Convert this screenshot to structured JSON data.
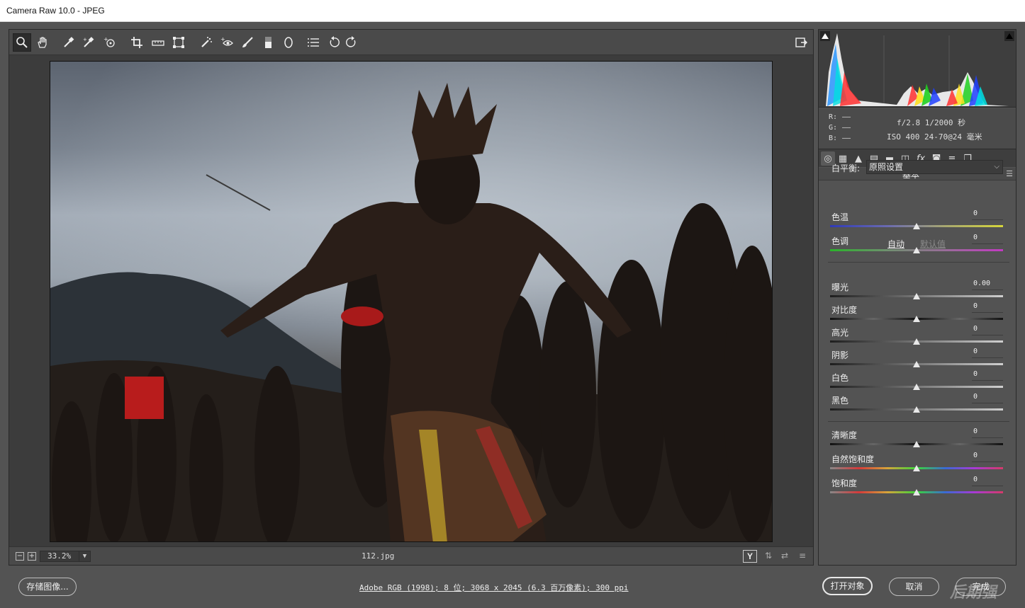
{
  "window": {
    "title": "Camera Raw 10.0 -  JPEG"
  },
  "toolbar": {
    "tools": [
      {
        "name": "zoom-tool",
        "glyph": "zoom",
        "active": true
      },
      {
        "name": "hand-tool",
        "glyph": "hand"
      },
      {
        "name": "white-balance-tool",
        "glyph": "eyedropper"
      },
      {
        "name": "color-sampler-tool",
        "glyph": "sampler"
      },
      {
        "name": "targeted-adjustment-tool",
        "glyph": "target"
      },
      {
        "name": "crop-tool",
        "glyph": "crop"
      },
      {
        "name": "straighten-tool",
        "glyph": "level"
      },
      {
        "name": "transform-tool",
        "glyph": "transform"
      },
      {
        "name": "spot-removal-tool",
        "glyph": "spot"
      },
      {
        "name": "red-eye-tool",
        "glyph": "eye"
      },
      {
        "name": "adjustment-brush-tool",
        "glyph": "brush"
      },
      {
        "name": "graduated-filter-tool",
        "glyph": "gradient"
      },
      {
        "name": "radial-filter-tool",
        "glyph": "radial"
      },
      {
        "name": "preferences-tool",
        "glyph": "list"
      },
      {
        "name": "rotate-ccw-tool",
        "glyph": "rotccw"
      },
      {
        "name": "rotate-cw-tool",
        "glyph": "rotcw"
      }
    ],
    "fullscreen_icon": "fullscreen-icon"
  },
  "statusbar": {
    "zoom_out": "−",
    "zoom_in": "+",
    "zoom_value": "33.2%",
    "filename": "112.jpg",
    "view_y": "Y"
  },
  "histogram": {
    "rgb_labels": [
      "R:",
      "G:",
      "B:"
    ],
    "rgb_values": [
      "——",
      "——",
      "——"
    ],
    "aperture_shutter": "f/2.8   1/2000 秒",
    "iso_lens": "ISO 400   24-70@24 毫米"
  },
  "panel": {
    "title": "基本",
    "white_balance_label": "白平衡:",
    "white_balance_value": "原照设置",
    "auto_label": "自动",
    "default_label": "默认值",
    "sliders_wb": [
      {
        "label": "色温",
        "value": "0",
        "level": 0.5
      },
      {
        "label": "色调",
        "value": "0",
        "level": 0.5
      }
    ],
    "sliders_tone": [
      {
        "label": "曝光",
        "value": "0.00",
        "level": 0.5
      },
      {
        "label": "对比度",
        "value": "0",
        "level": 0.5
      },
      {
        "label": "高光",
        "value": "0",
        "level": 0.5
      },
      {
        "label": "阴影",
        "value": "0",
        "level": 0.5
      },
      {
        "label": "白色",
        "value": "0",
        "level": 0.5
      },
      {
        "label": "黑色",
        "value": "0",
        "level": 0.5
      }
    ],
    "sliders_presence": [
      {
        "label": "清晰度",
        "value": "0",
        "level": 0.5
      },
      {
        "label": "自然饱和度",
        "value": "0",
        "level": 0.5
      },
      {
        "label": "饱和度",
        "value": "0",
        "level": 0.5
      }
    ]
  },
  "bottom": {
    "save_image": "存储图像...",
    "workflow_options": "Adobe RGB (1998); 8 位; 3068 x 2045 (6.3 百万像素); 300 ppi",
    "open_object": "打开对象",
    "cancel": "取消",
    "done": "完成",
    "watermark": "后期强"
  }
}
